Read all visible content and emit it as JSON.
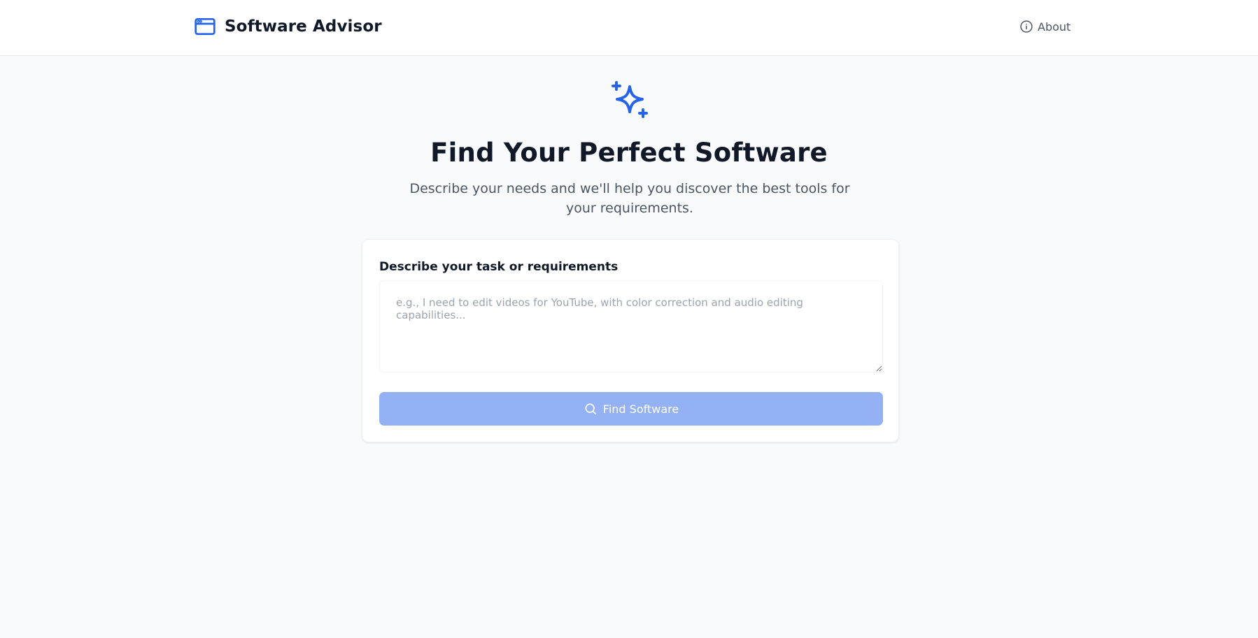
{
  "header": {
    "app_title": "Software Advisor",
    "app_icon": "browser-window-icon",
    "about_label": "About",
    "about_icon": "info-icon"
  },
  "hero": {
    "icon": "sparkles-icon",
    "title": "Find Your Perfect Software",
    "subtitle": "Describe your needs and we'll help you discover the best tools for your requirements."
  },
  "form": {
    "label": "Describe your task or requirements",
    "placeholder": "e.g., I need to edit videos for YouTube, with color correction and audio editing capabilities...",
    "value": "",
    "submit_label": "Find Software",
    "submit_icon": "search-icon",
    "submit_disabled": true
  },
  "colors": {
    "accent": "#2563eb",
    "button_disabled": "#93b1f3",
    "background": "#f9fafb",
    "text_primary": "#111827",
    "text_secondary": "#4b5563",
    "placeholder": "#9ca3af"
  }
}
